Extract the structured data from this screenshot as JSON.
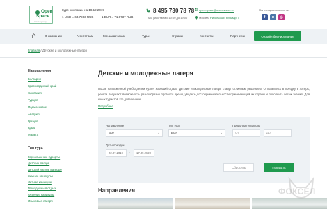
{
  "header": {
    "logo": {
      "line1": "Open",
      "line2": "Space",
      "tagline": "travel agency"
    },
    "rates": {
      "title": "Курс компании на 18.12.2019",
      "usd": "1 USD = 63.7933 RUB",
      "eur": "1 EUR = 71.0737 RUB"
    },
    "phone": "8 495 730 78 78",
    "hours": "Мы работаем с 10:00 до 19:00",
    "email": "open-space@open-space.ru",
    "address_city": "Москва,",
    "address_link": "Никольский бульвар, 5",
    "social_label": "Мы в социальных сетях",
    "social": [
      "facebook-icon",
      "vk-icon",
      "instagram-icon"
    ]
  },
  "nav": {
    "items": [
      "О компании",
      "Агентствам",
      "Гос.заказчикам",
      "Туры",
      "Страны",
      "Контакты",
      "Партнеры"
    ],
    "cta": "Онлайн бронирование"
  },
  "breadcrumb": {
    "home": "Главная",
    "sep": "/",
    "current": "Детские и молодежные лагеря"
  },
  "sidebar": {
    "directions_title": "Направления",
    "directions": [
      "Болгария",
      "Краснодарский край",
      "Словакия",
      "Турция",
      "Подмосковье",
      "Австрия",
      "Греция",
      "Крым",
      "Мальта"
    ],
    "types_title": "Тип тура",
    "types": [
      "Горнолыжные курорты",
      "Детские лагеря",
      "Детский лагерь на море",
      "Зимние каникулы",
      "Летние каникулы",
      "Молодежный отдых",
      "Осенние каникулы",
      "Языковые лагеря"
    ]
  },
  "main": {
    "title": "Детские и молодежные лагеря",
    "intro": "После напряженной учебы детям нужен хороший отдых. Детские и молодежные лагеря станут отличным решением. Отправляясь в поездку в лагерь, ребята получают возможность разнообразно провести время, увидеть достопримечательности принимающей их страны и пополнить багаж знаний. Для юных туристов это доверенные",
    "more": "Подробнее",
    "filter": {
      "direction_label": "Направление",
      "direction_value": "Все",
      "type_label": "Тип тура",
      "type_value": "Все",
      "duration_label": "Продолжительность",
      "from_placeholder": "От",
      "to_placeholder": "До",
      "dates_label": "Даты поездки",
      "date_from": "22.07.2019",
      "date_to": "17.09.2020",
      "reset": "Сбросить",
      "show": "Показать"
    },
    "directions_heading": "Направления"
  },
  "watermark": "ФОКСЕЛ",
  "colors": {
    "accent": "#1f9a4e",
    "link": "#1e8a4a",
    "nav_bg": "#eef2f5"
  }
}
